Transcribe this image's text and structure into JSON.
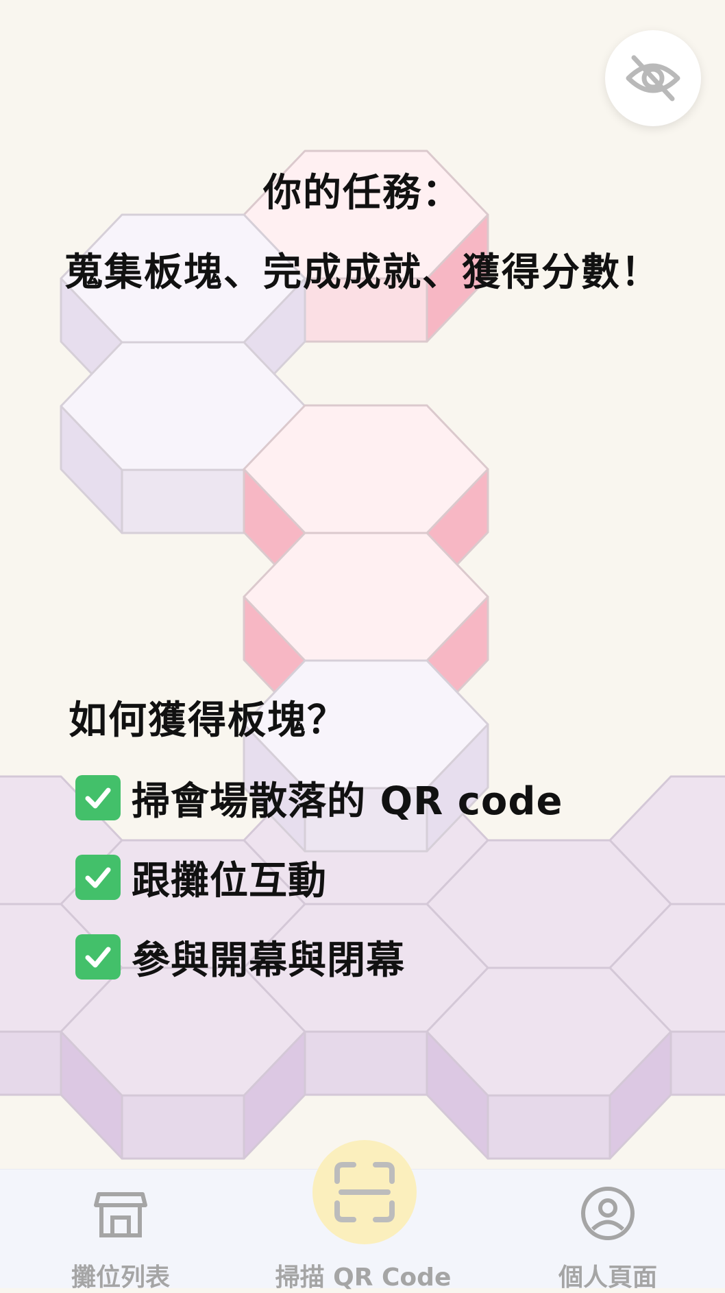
{
  "colors": {
    "background": "#f9f6ef",
    "hex_lavender": "#f8f4fb",
    "hex_pink": "#fff0f2",
    "hex_purple": "#eee3ef",
    "check_green": "#43c06a",
    "scan_yellow": "#fbefbd",
    "nav_gray": "#a5a5a5"
  },
  "hide_button": {
    "icon": "eye-off-icon"
  },
  "mission": {
    "title": "你的任務：",
    "subtitle": "蒐集板塊、完成成就、獲得分數！"
  },
  "how": {
    "title": "如何獲得板塊？",
    "items": [
      {
        "icon": "check-mark-icon",
        "label": "掃會場散落的 QR code"
      },
      {
        "icon": "check-mark-icon",
        "label": "跟攤位互動"
      },
      {
        "icon": "check-mark-icon",
        "label": "參與開幕與閉幕"
      }
    ]
  },
  "nav": {
    "booths": {
      "icon": "store-icon",
      "label": "攤位列表"
    },
    "scan": {
      "icon": "qr-scan-icon",
      "label": "掃描 QR Code"
    },
    "profile": {
      "icon": "user-circle-icon",
      "label": "個人頁面"
    }
  }
}
